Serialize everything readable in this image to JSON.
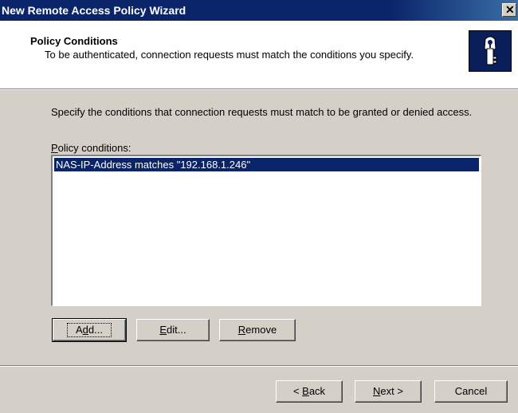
{
  "window": {
    "title": "New Remote Access Policy Wizard",
    "close_glyph": "✕"
  },
  "header": {
    "heading": "Policy Conditions",
    "subheading": "To be authenticated, connection requests must match the conditions you specify.",
    "icon": "key-lock-icon"
  },
  "body": {
    "instructions": "Specify the conditions that connection requests must match to be granted or denied access.",
    "list_label_accel": "P",
    "list_label_rest": "olicy conditions:",
    "conditions": [
      "NAS-IP-Address matches \"192.168.1.246\""
    ]
  },
  "buttons": {
    "add": {
      "accel": "d",
      "pre": "A",
      "post": "d..."
    },
    "edit": {
      "pre": "",
      "accel": "E",
      "post": "dit..."
    },
    "remove": {
      "pre": "",
      "accel": "R",
      "post": "emove"
    },
    "back": {
      "pre": "< ",
      "accel": "B",
      "post": "ack"
    },
    "next": {
      "pre": "",
      "accel": "N",
      "post": "ext >"
    },
    "cancel": {
      "label": "Cancel"
    }
  },
  "colors": {
    "title_bar": "#0a246a",
    "selection": "#0a246a",
    "face": "#d4d0c8"
  }
}
